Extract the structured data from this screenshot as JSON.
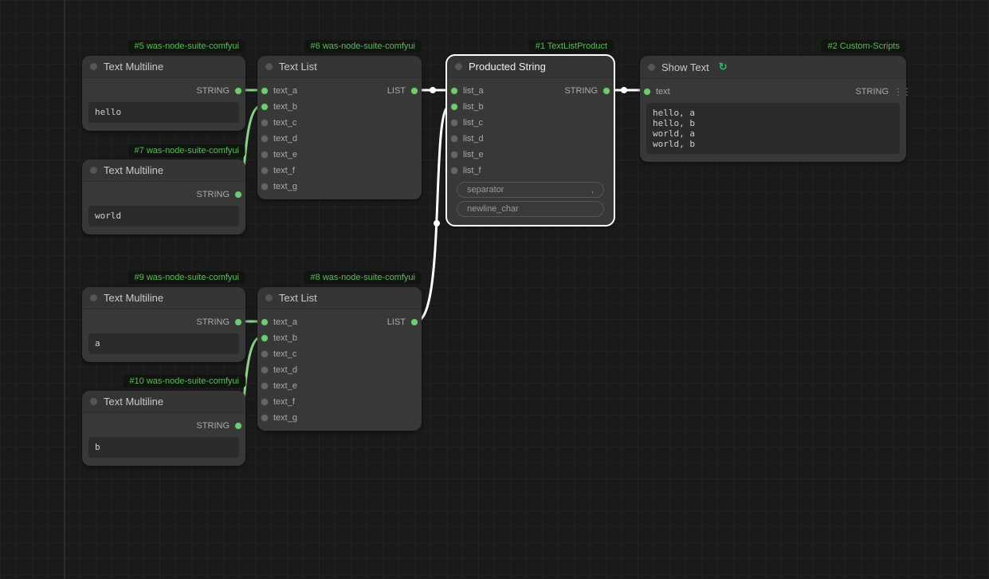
{
  "tags": {
    "n5": "#5 was-node-suite-comfyui",
    "n6": "#6 was-node-suite-comfyui",
    "n1": "#1 TextListProduct",
    "n2": "#2 Custom-Scripts",
    "n7": "#7 was-node-suite-comfyui",
    "n9": "#9 was-node-suite-comfyui",
    "n8": "#8 was-node-suite-comfyui",
    "n10": "#10 was-node-suite-comfyui"
  },
  "nodes": {
    "text_multiline": {
      "title": "Text Multiline",
      "output": "STRING"
    },
    "text_list": {
      "title": "Text List",
      "output": "LIST",
      "inputs": [
        "text_a",
        "text_b",
        "text_c",
        "text_d",
        "text_e",
        "text_f",
        "text_g"
      ]
    },
    "producted_string": {
      "title": "Producted String",
      "output": "STRING",
      "inputs": [
        "list_a",
        "list_b",
        "list_c",
        "list_d",
        "list_e",
        "list_f"
      ],
      "widgets": {
        "separator": {
          "label": "separator",
          "value": ","
        },
        "newline": {
          "label": "newline_char",
          "value": ""
        }
      }
    },
    "show_text": {
      "title": "Show Text",
      "output": "STRING",
      "input": "text"
    }
  },
  "values": {
    "n5_text": "hello",
    "n7_text": "world",
    "n9_text": "a",
    "n10_text": "b",
    "show_text_result": "hello, a\nhello, b\nworld, a\nworld, b"
  }
}
